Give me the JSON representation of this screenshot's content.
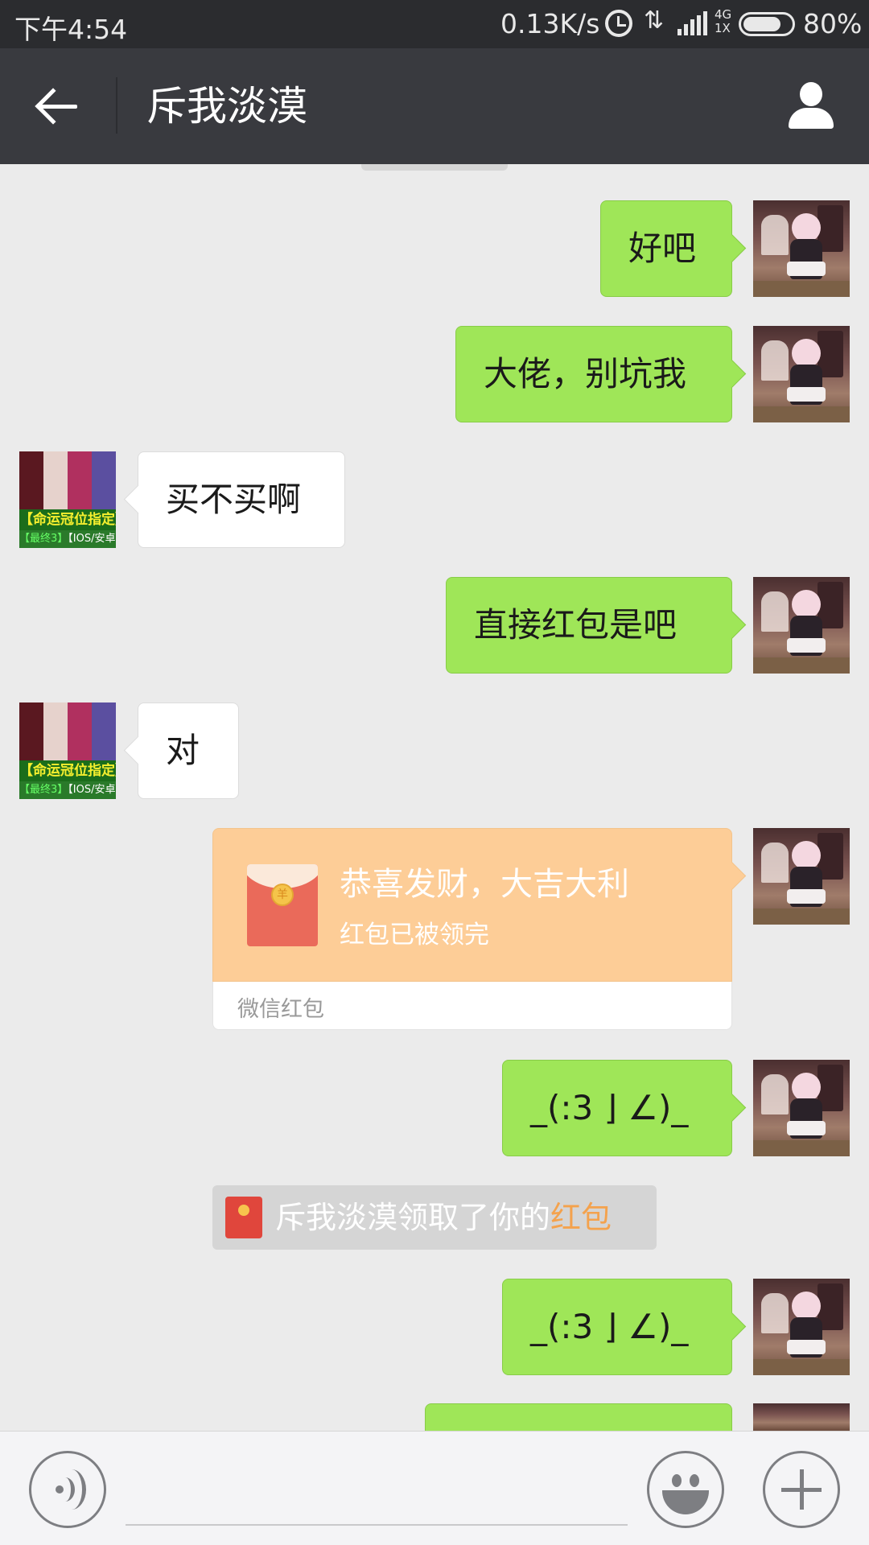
{
  "status_bar": {
    "time": "下午4:54",
    "net_speed": "0.13K/s",
    "network_type_top": "4G",
    "network_type_bottom": "1X",
    "battery_percent": "80%",
    "battery_level": 0.8,
    "icons": [
      "alarm-icon",
      "data-arrows-icon",
      "signal-icon",
      "battery-icon"
    ]
  },
  "header": {
    "title": "斥我淡漠",
    "icons": [
      "back-arrow-icon",
      "profile-icon"
    ]
  },
  "messages": [
    {
      "sender": "me",
      "type": "text",
      "text": "好吧"
    },
    {
      "sender": "me",
      "type": "text",
      "text": "大佬，别坑我"
    },
    {
      "sender": "other",
      "type": "text",
      "text": "买不买啊"
    },
    {
      "sender": "me",
      "type": "text",
      "text": "直接红包是吧"
    },
    {
      "sender": "other",
      "type": "text",
      "text": "对"
    },
    {
      "sender": "me",
      "type": "red_packet",
      "greeting": "恭喜发财，大吉大利",
      "status": "红包已被领完",
      "footer": "微信红包",
      "coin_char": "羊"
    },
    {
      "sender": "me",
      "type": "text",
      "text": "_(:3 ⌋ ∠)_"
    },
    {
      "sender": "system",
      "type": "notice",
      "prefix": "斥我淡漠领取了你的",
      "link": "红包"
    },
    {
      "sender": "me",
      "type": "text",
      "text": "_(:3 ⌋ ∠)_"
    }
  ],
  "other_avatar": {
    "line1": "【命运冠位指定】",
    "line2_green": "【最终3】",
    "line2": "【IOS/安卓】"
  },
  "input_bar": {
    "icons": [
      "voice-icon",
      "emoji-icon",
      "plus-icon"
    ]
  },
  "colors": {
    "my_bubble": "#9fe658",
    "other_bubble": "#ffffff",
    "title_bar": "#393a3f",
    "status_bar": "#2b2c2f",
    "chat_bg": "#ebebeb",
    "red_packet": "#fdcd97",
    "link": "#f4a24d"
  }
}
